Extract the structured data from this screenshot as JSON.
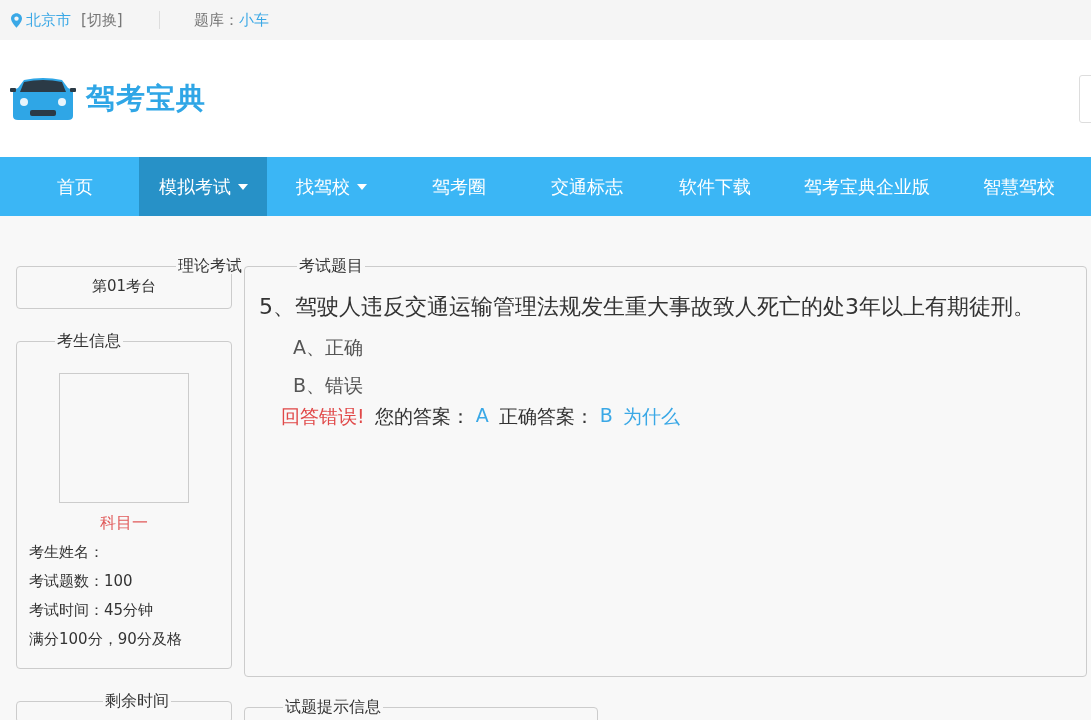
{
  "top_bar": {
    "city": "北京市",
    "switch_link": "[切换]",
    "bank_label": "题库：",
    "bank_value": "小车"
  },
  "logo": {
    "text": "驾考宝典"
  },
  "nav": [
    {
      "label": "首页",
      "selected": false,
      "dropdown": false
    },
    {
      "label": "模拟考试",
      "selected": true,
      "dropdown": true
    },
    {
      "label": "找驾校",
      "selected": false,
      "dropdown": true
    },
    {
      "label": "驾考圈",
      "selected": false,
      "dropdown": false
    },
    {
      "label": "交通标志",
      "selected": false,
      "dropdown": false
    },
    {
      "label": "软件下载",
      "selected": false,
      "dropdown": false
    },
    {
      "label": "驾考宝典企业版",
      "selected": false,
      "dropdown": false
    },
    {
      "label": "智慧驾校",
      "selected": false,
      "dropdown": false
    }
  ],
  "exam_panel": {
    "legend": "理论考试",
    "station": "第01考台"
  },
  "candidate_panel": {
    "legend": "考生信息",
    "subject": "科目一",
    "lines": [
      "考生姓名：",
      "考试题数：100",
      "考试时间：45分钟",
      "满分100分，90分及格"
    ]
  },
  "question_panel": {
    "legend": "考试题目",
    "question": "5、驾驶人违反交通运输管理法规发生重大事故致人死亡的处3年以上有期徒刑。",
    "options": [
      "A、正确",
      "B、错误"
    ],
    "result": {
      "status": "回答错误!",
      "your_label": "您的答案：",
      "your_answer": "A",
      "correct_label": "正确答案：",
      "correct_answer": "B",
      "why_link": "为什么"
    }
  },
  "time_panel": {
    "legend": "剩余时间"
  },
  "hint_panel": {
    "legend": "试题提示信息"
  }
}
